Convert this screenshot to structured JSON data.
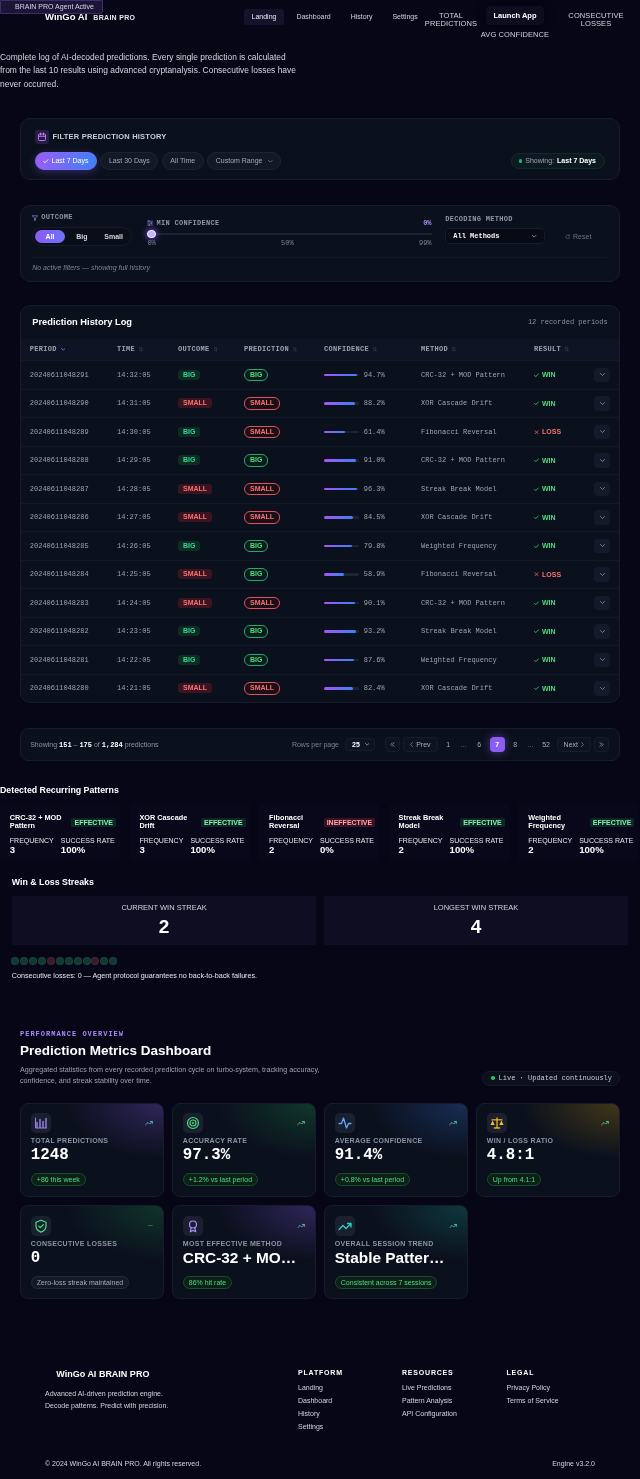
{
  "agent_badge": "BRAIN PRO Agent Active",
  "header": {
    "logo": "WinGo AI",
    "logo_tag": "BRAIN PRO",
    "nav": [
      {
        "label": "Landing",
        "selected": true
      },
      {
        "label": "Dashboard",
        "selected": false
      },
      {
        "label": "History",
        "selected": false
      },
      {
        "label": "Settings",
        "selected": false
      }
    ],
    "stats": [
      "TOTAL PREDICTIONS",
      "AVG CONFIDENCE",
      "CONSECUTIVE LOSSES"
    ],
    "action": "Launch App"
  },
  "intro": "Complete log of AI-decoded predictions. Every single prediction is calculated from the last 10 results using advanced cryptanalysis. Consecutive losses have never occurred.",
  "date_filter": {
    "title": "FILTER PREDICTION HISTORY",
    "ranges": [
      {
        "label": "Last 7 Days",
        "kind": "preset",
        "selected": true
      },
      {
        "label": "Last 30 Days",
        "kind": "preset",
        "selected": false
      },
      {
        "label": "All Time",
        "kind": "preset",
        "selected": false
      },
      {
        "label": "Custom Range",
        "kind": "dropdown",
        "selected": false
      }
    ],
    "showing_label": "Showing:",
    "showing_value": "Last 7 Days"
  },
  "filters": {
    "outcome_label": "OUTCOME",
    "outcomes": [
      {
        "label": "All",
        "selected": true
      },
      {
        "label": "Big",
        "selected": false
      },
      {
        "label": "Small",
        "selected": false
      }
    ],
    "confidence_label": "MIN CONFIDENCE",
    "confidence_reading": "0%",
    "level": 0,
    "ticks": [
      "0%",
      "50%",
      "99%"
    ],
    "method_label": "DECODING METHOD",
    "method_value": "All Methods",
    "reset": {
      "label": "Reset",
      "disabled": true
    },
    "note": "No active filters — showing full history"
  },
  "table": {
    "title": "Prediction History Log",
    "count": "12 recorded periods",
    "columns": [
      {
        "label": "PERIOD",
        "sorted": true
      },
      {
        "label": "TIME",
        "sorted": false
      },
      {
        "label": "OUTCOME",
        "sorted": false
      },
      {
        "label": "PREDICTION",
        "sorted": false
      },
      {
        "label": "CONFIDENCE",
        "sorted": false
      },
      {
        "label": "METHOD",
        "sorted": false
      },
      {
        "label": "RESULT",
        "sorted": false
      }
    ],
    "rows": [
      {
        "period": "20240611048291",
        "time": "14:32:05",
        "outcome": {
          "text": "BIG",
          "kind": "big"
        },
        "prediction": {
          "text": "BIG",
          "kind": "big"
        },
        "confidence": {
          "level": 0.947,
          "reading": "94.7%"
        },
        "method": "CRC-32 + MOD Pattern",
        "result": {
          "text": "WIN",
          "kind": "win"
        }
      },
      {
        "period": "20240611048290",
        "time": "14:31:05",
        "outcome": {
          "text": "SMALL",
          "kind": "small"
        },
        "prediction": {
          "text": "SMALL",
          "kind": "small"
        },
        "confidence": {
          "level": 0.882,
          "reading": "88.2%"
        },
        "method": "XOR Cascade Drift",
        "result": {
          "text": "WIN",
          "kind": "win"
        }
      },
      {
        "period": "20240611048289",
        "time": "14:30:05",
        "outcome": {
          "text": "BIG",
          "kind": "big"
        },
        "prediction": {
          "text": "SMALL",
          "kind": "small"
        },
        "confidence": {
          "level": 0.614,
          "reading": "61.4%"
        },
        "method": "Fibonacci Reversal",
        "result": {
          "text": "LOSS",
          "kind": "loss"
        }
      },
      {
        "period": "20240611048288",
        "time": "14:29:05",
        "outcome": {
          "text": "BIG",
          "kind": "big"
        },
        "prediction": {
          "text": "BIG",
          "kind": "big"
        },
        "confidence": {
          "level": 0.91,
          "reading": "91.0%"
        },
        "method": "CRC-32 + MOD Pattern",
        "result": {
          "text": "WIN",
          "kind": "win"
        }
      },
      {
        "period": "20240611048287",
        "time": "14:28:05",
        "outcome": {
          "text": "SMALL",
          "kind": "small"
        },
        "prediction": {
          "text": "SMALL",
          "kind": "small"
        },
        "confidence": {
          "level": 0.963,
          "reading": "96.3%"
        },
        "method": "Streak Break Model",
        "result": {
          "text": "WIN",
          "kind": "win"
        }
      },
      {
        "period": "20240611048286",
        "time": "14:27:05",
        "outcome": {
          "text": "SMALL",
          "kind": "small"
        },
        "prediction": {
          "text": "SMALL",
          "kind": "small"
        },
        "confidence": {
          "level": 0.845,
          "reading": "84.5%"
        },
        "method": "XOR Cascade Drift",
        "result": {
          "text": "WIN",
          "kind": "win"
        }
      },
      {
        "period": "20240611048285",
        "time": "14:26:05",
        "outcome": {
          "text": "BIG",
          "kind": "big"
        },
        "prediction": {
          "text": "BIG",
          "kind": "big"
        },
        "confidence": {
          "level": 0.798,
          "reading": "79.8%"
        },
        "method": "Weighted Frequency",
        "result": {
          "text": "WIN",
          "kind": "win"
        }
      },
      {
        "period": "20240611048284",
        "time": "14:25:05",
        "outcome": {
          "text": "SMALL",
          "kind": "small"
        },
        "prediction": {
          "text": "BIG",
          "kind": "big"
        },
        "confidence": {
          "level": 0.589,
          "reading": "58.9%"
        },
        "method": "Fibonacci Reversal",
        "result": {
          "text": "LOSS",
          "kind": "loss"
        }
      },
      {
        "period": "20240611048283",
        "time": "14:24:05",
        "outcome": {
          "text": "SMALL",
          "kind": "small"
        },
        "prediction": {
          "text": "SMALL",
          "kind": "small"
        },
        "confidence": {
          "level": 0.901,
          "reading": "90.1%"
        },
        "method": "CRC-32 + MOD Pattern",
        "result": {
          "text": "WIN",
          "kind": "win"
        }
      },
      {
        "period": "20240611048282",
        "time": "14:23:05",
        "outcome": {
          "text": "BIG",
          "kind": "big"
        },
        "prediction": {
          "text": "BIG",
          "kind": "big"
        },
        "confidence": {
          "level": 0.932,
          "reading": "93.2%"
        },
        "method": "Streak Break Model",
        "result": {
          "text": "WIN",
          "kind": "win"
        }
      },
      {
        "period": "20240611048281",
        "time": "14:22:05",
        "outcome": {
          "text": "BIG",
          "kind": "big"
        },
        "prediction": {
          "text": "BIG",
          "kind": "big"
        },
        "confidence": {
          "level": 0.876,
          "reading": "87.6%"
        },
        "method": "Weighted Frequency",
        "result": {
          "text": "WIN",
          "kind": "win"
        }
      },
      {
        "period": "20240611048280",
        "time": "14:21:05",
        "outcome": {
          "text": "SMALL",
          "kind": "small"
        },
        "prediction": {
          "text": "SMALL",
          "kind": "small"
        },
        "confidence": {
          "level": 0.824,
          "reading": "82.4%"
        },
        "method": "XOR Cascade Drift",
        "result": {
          "text": "WIN",
          "kind": "win"
        }
      }
    ]
  },
  "pagination": {
    "summary": "Showing **151** – **175** of **1,284** predictions",
    "rows_label": "Rows per page",
    "rows_value": "25",
    "prev": "Prev",
    "next": "Next",
    "pages": [
      {
        "label": "1",
        "kind": "page",
        "selected": false
      },
      {
        "label": "…",
        "kind": "gap"
      },
      {
        "label": "6",
        "kind": "page",
        "selected": false
      },
      {
        "label": "7",
        "kind": "page",
        "selected": true
      },
      {
        "label": "8",
        "kind": "page",
        "selected": false
      },
      {
        "label": "…",
        "kind": "gap"
      },
      {
        "label": "52",
        "kind": "page",
        "selected": false
      }
    ]
  },
  "patterns": {
    "title": "Detected Recurring Patterns",
    "items": [
      {
        "name": "CRC-32 + MOD Pattern",
        "status": {
          "text": "EFFECTIVE",
          "kind": "effective"
        },
        "frequency_label": "FREQUENCY",
        "frequency": "3",
        "rate_label": "SUCCESS RATE",
        "rate": "100%"
      },
      {
        "name": "XOR Cascade Drift",
        "status": {
          "text": "EFFECTIVE",
          "kind": "effective"
        },
        "frequency_label": "FREQUENCY",
        "frequency": "3",
        "rate_label": "SUCCESS RATE",
        "rate": "100%"
      },
      {
        "name": "Fibonacci Reversal",
        "status": {
          "text": "INEFFECTIVE",
          "kind": "ineffective"
        },
        "frequency_label": "FREQUENCY",
        "frequency": "2",
        "rate_label": "SUCCESS RATE",
        "rate": "0%"
      },
      {
        "name": "Streak Break Model",
        "status": {
          "text": "EFFECTIVE",
          "kind": "effective"
        },
        "frequency_label": "FREQUENCY",
        "frequency": "2",
        "rate_label": "SUCCESS RATE",
        "rate": "100%"
      },
      {
        "name": "Weighted Frequency",
        "status": {
          "text": "EFFECTIVE",
          "kind": "effective"
        },
        "frequency_label": "FREQUENCY",
        "frequency": "2",
        "rate_label": "SUCCESS RATE",
        "rate": "100%"
      }
    ]
  },
  "streaks": {
    "title": "Win & Loss Streaks",
    "cards": [
      {
        "label": "CURRENT WIN STREAK",
        "value": "2"
      },
      {
        "label": "LONGEST WIN STREAK",
        "value": "4"
      }
    ],
    "history": [
      {
        "color": "#0f3a33"
      },
      {
        "color": "#0f3a33"
      },
      {
        "color": "#0f3a33"
      },
      {
        "color": "#0f3a33"
      },
      {
        "color": "#3d1a2a"
      },
      {
        "color": "#0f3a33"
      },
      {
        "color": "#0f3a33"
      },
      {
        "color": "#0f3a33"
      },
      {
        "color": "#0f3a33"
      },
      {
        "color": "#3d1a2a"
      },
      {
        "color": "#0f3a33"
      },
      {
        "color": "#0f3a33"
      }
    ],
    "note": "Consecutive losses: 0 — Agent protocol guarantees no back-to-back failures."
  },
  "metrics": {
    "eyebrow": "PERFORMANCE OVERVIEW",
    "title": "Prediction Metrics Dashboard",
    "description": "Aggregated statistics from every recorded prediction cycle on turbo-system, tracking accuracy, confidence, and streak stability over time.",
    "live": "Live · Updated continuously",
    "cards": [
      {
        "label": "TOTAL PREDICTIONS",
        "value": "1248",
        "kind": "number",
        "trend_up": true,
        "note": "+86 this week",
        "positive": true
      },
      {
        "label": "ACCURACY RATE",
        "value": "97.3%",
        "kind": "number",
        "trend_up": true,
        "note": "+1.2% vs last period",
        "positive": true
      },
      {
        "label": "AVERAGE CONFIDENCE",
        "value": "91.4%",
        "kind": "number",
        "trend_up": true,
        "note": "+0.8% vs last period",
        "positive": true
      },
      {
        "label": "WIN / LOSS RATIO",
        "value": "4.8:1",
        "kind": "number",
        "trend_up": true,
        "note": "Up from 4.1:1",
        "positive": true
      },
      {
        "label": "CONSECUTIVE LOSSES",
        "value": "0",
        "kind": "number",
        "trend_up": false,
        "note": "Zero-loss streak maintained",
        "positive": false
      },
      {
        "label": "MOST EFFECTIVE METHOD",
        "value": "CRC-32 + MO…",
        "kind": "text",
        "trend_up": true,
        "note": "86% hit rate",
        "positive": true
      },
      {
        "label": "OVERALL SESSION TREND",
        "value": "Stable Patter…",
        "kind": "text",
        "trend_up": true,
        "note": "Consistent across 7 sessions",
        "positive": true
      }
    ]
  },
  "footer": {
    "brand": "WinGo AI BRAIN PRO",
    "tagline": "Advanced AI-driven prediction engine. Decode patterns. Predict with precision.",
    "columns": [
      {
        "heading": "PLATFORM",
        "links": [
          "Landing",
          "Dashboard",
          "History",
          "Settings"
        ]
      },
      {
        "heading": "RESOURCES",
        "links": [
          "Live Predictions",
          "Pattern Analysis",
          "API Configuration"
        ]
      },
      {
        "heading": "LEGAL",
        "links": [
          "Privacy Policy",
          "Terms of Service"
        ]
      }
    ],
    "copyright": "© 2024 WinGo AI BRAIN PRO. All rights reserved.",
    "version": "Engine v3.2.0"
  }
}
